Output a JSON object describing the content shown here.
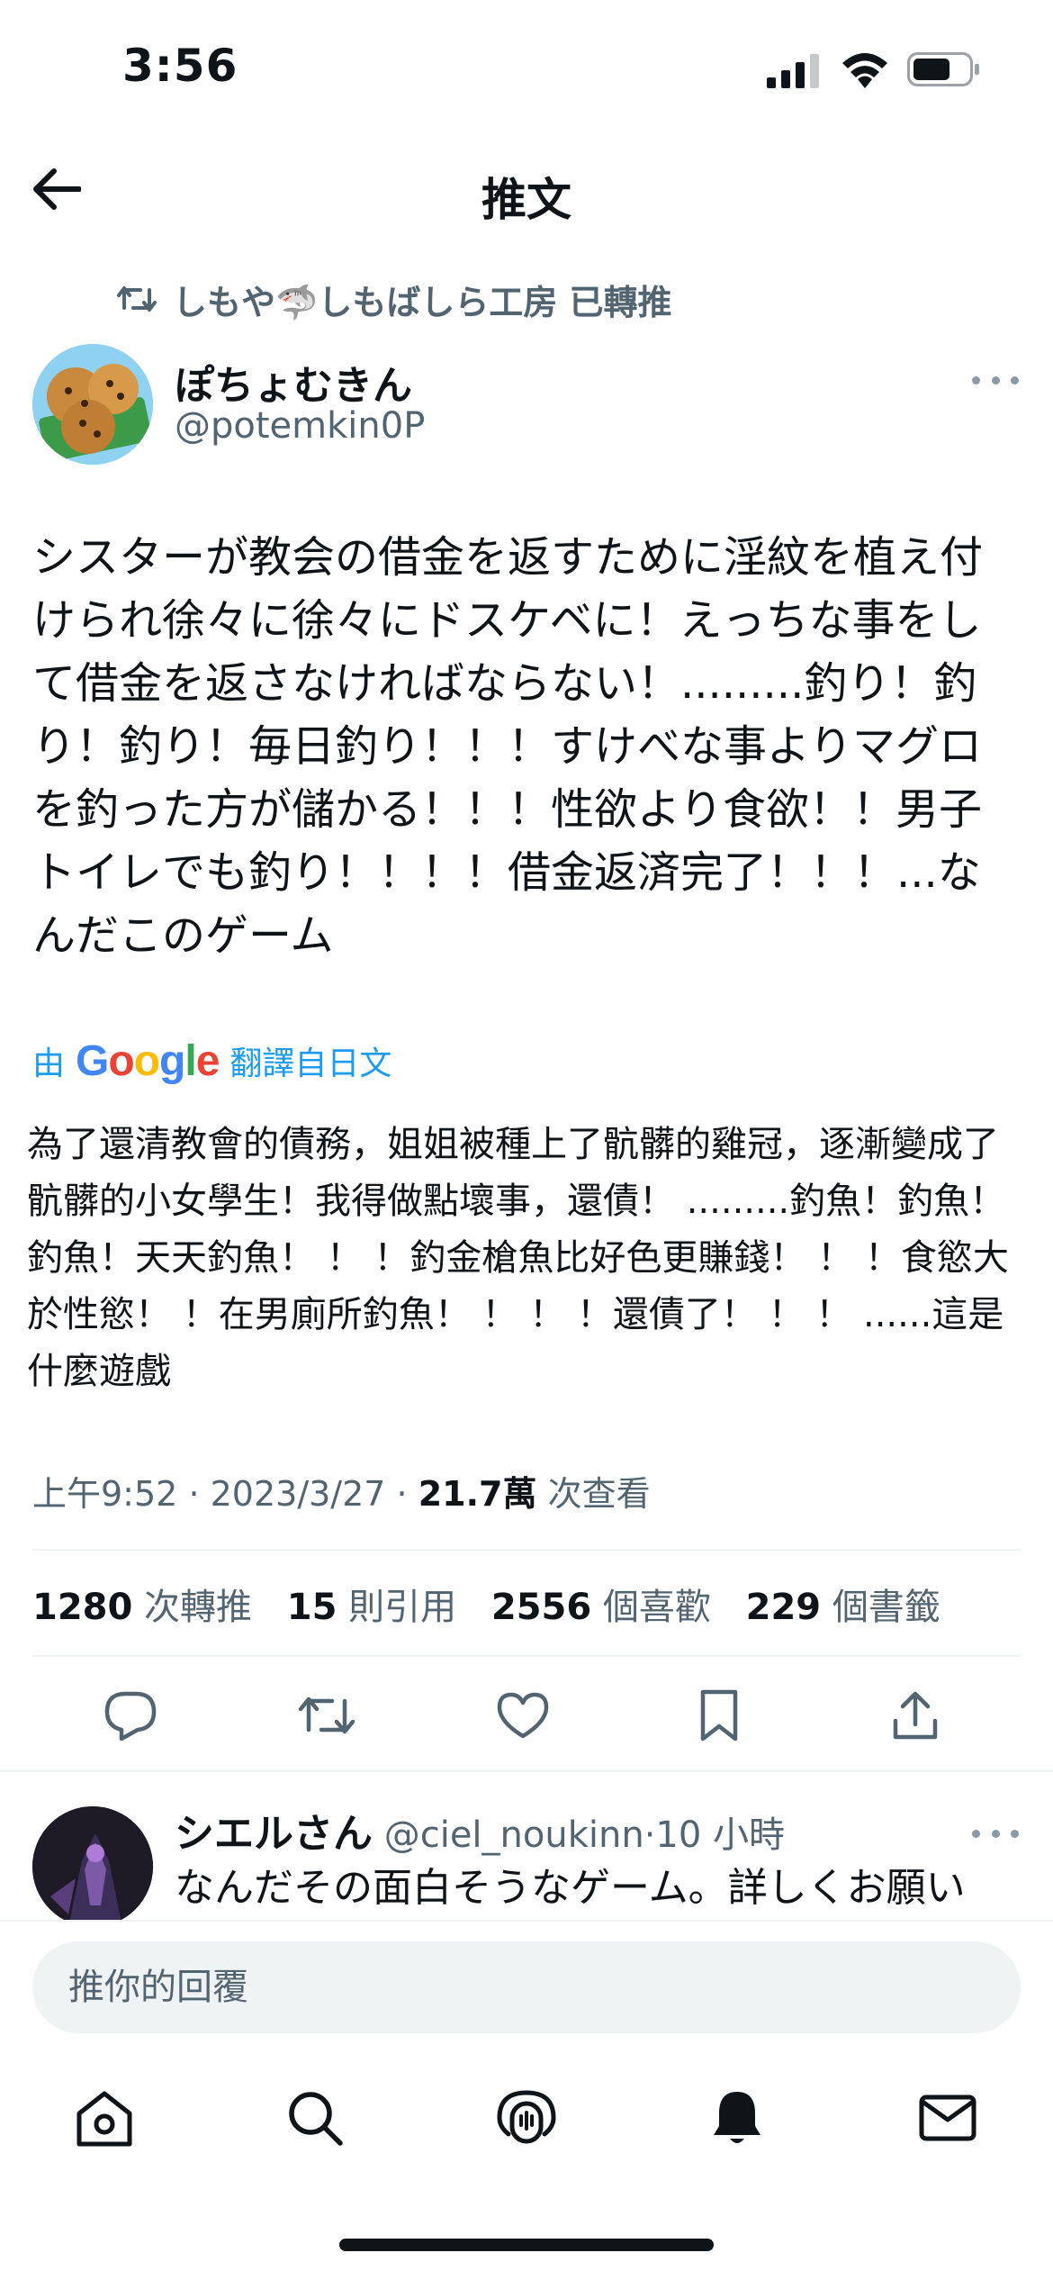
{
  "status_bar": {
    "time": "3:56"
  },
  "header": {
    "title": "推文"
  },
  "retweet": {
    "text": "しもや🦈しもばしら工房 已轉推"
  },
  "tweet": {
    "author_name": "ぽちょむきん",
    "author_handle": "@potemkin0P",
    "text": "シスターが教会の借金を返すために淫紋を植え付けられ徐々に徐々にドスケベに！えっちな事をして借金を返さなければならない！.........釣り！釣り！釣り！毎日釣り！！！すけべな事よりマグロを釣った方が儲かる！！！性欲より食欲！！男子トイレでも釣り！！！！借金返済完了！！！...なんだこのゲーム",
    "translate_prefix": "由",
    "translate_brand": "Google",
    "translate_suffix": "翻譯自日文",
    "translated_text": "為了還清教會的債務，姐姐被種上了骯髒的雞冠，逐漸變成了骯髒的小女學生！我得做點壞事，還債！ .........釣魚！釣魚！釣魚！天天釣魚！ ！ ！釣金槍魚比好色更賺錢！ ！ ！食慾大於性慾！ ！在男廁所釣魚！ ！ ！ ！還債了！ ！ ！ ......這是什麼遊戲",
    "time": "上午9:52",
    "date": "2023/3/27",
    "views_count": "21.7萬",
    "views_label": "次查看"
  },
  "stats": {
    "retweets_count": "1280",
    "retweets_label": "次轉推",
    "quotes_count": "15",
    "quotes_label": "則引用",
    "likes_count": "2556",
    "likes_label": "個喜歡",
    "bookmarks_count": "229",
    "bookmarks_label": "個書籤"
  },
  "reply": {
    "author_name": "シエルさん",
    "author_handle": "@ciel_noukinn",
    "time": "10 小時",
    "text": "なんだその面白そうなゲーム。詳しくお願い"
  },
  "composer": {
    "placeholder": "推你的回覆"
  },
  "colors": {
    "accent": "#1d9bf0",
    "secondary_text": "#536471",
    "primary_text": "#0f1419"
  },
  "icons": [
    "arrow-left-icon",
    "retweet-icon",
    "reply-icon",
    "like-icon",
    "bookmark-icon",
    "share-icon",
    "home-icon",
    "search-icon",
    "spaces-icon",
    "bell-icon",
    "mail-icon"
  ]
}
